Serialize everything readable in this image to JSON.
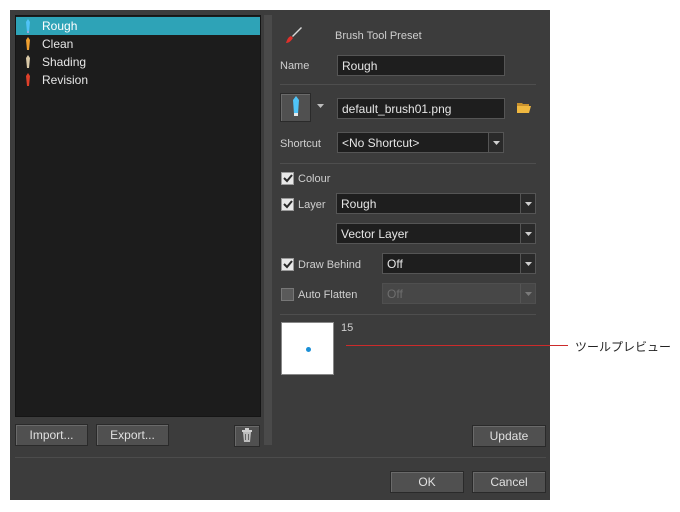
{
  "presets": [
    {
      "label": "Rough",
      "icon": "pencil-blue-icon",
      "color": "#4fc3f7",
      "selected": true
    },
    {
      "label": "Clean",
      "icon": "pencil-orange-icon",
      "color": "#f0a030",
      "selected": false
    },
    {
      "label": "Shading",
      "icon": "pencil-beige-icon",
      "color": "#d9c9a8",
      "selected": false
    },
    {
      "label": "Revision",
      "icon": "pencil-red-icon",
      "color": "#e0402a",
      "selected": false
    }
  ],
  "buttons": {
    "import": "Import...",
    "export": "Export...",
    "update": "Update",
    "ok": "OK",
    "cancel": "Cancel"
  },
  "header": {
    "title": "Brush Tool Preset",
    "icon": "brush-icon"
  },
  "name": {
    "label": "Name",
    "value": "Rough"
  },
  "tool": {
    "file": "default_brush01.png",
    "folder_icon": "folder-open-icon"
  },
  "shortcut": {
    "label": "Shortcut",
    "value": "<No Shortcut>"
  },
  "colour": {
    "label": "Colour",
    "checked": true
  },
  "layer": {
    "label": "Layer",
    "checked": true,
    "value": "Rough",
    "type_value": "Vector Layer"
  },
  "draw_behind": {
    "label": "Draw Behind",
    "checked": true,
    "value": "Off"
  },
  "auto_flatten": {
    "label": "Auto Flatten",
    "checked": false,
    "value": "Off"
  },
  "preview": {
    "size": "15"
  },
  "callout": {
    "text": "ツールプレビュー"
  },
  "colors": {
    "selection": "#2ea3b7",
    "dialog_bg": "#3c3c3c",
    "callout_line": "#cc2b2b",
    "preview_dot": "#1a8fd6"
  }
}
